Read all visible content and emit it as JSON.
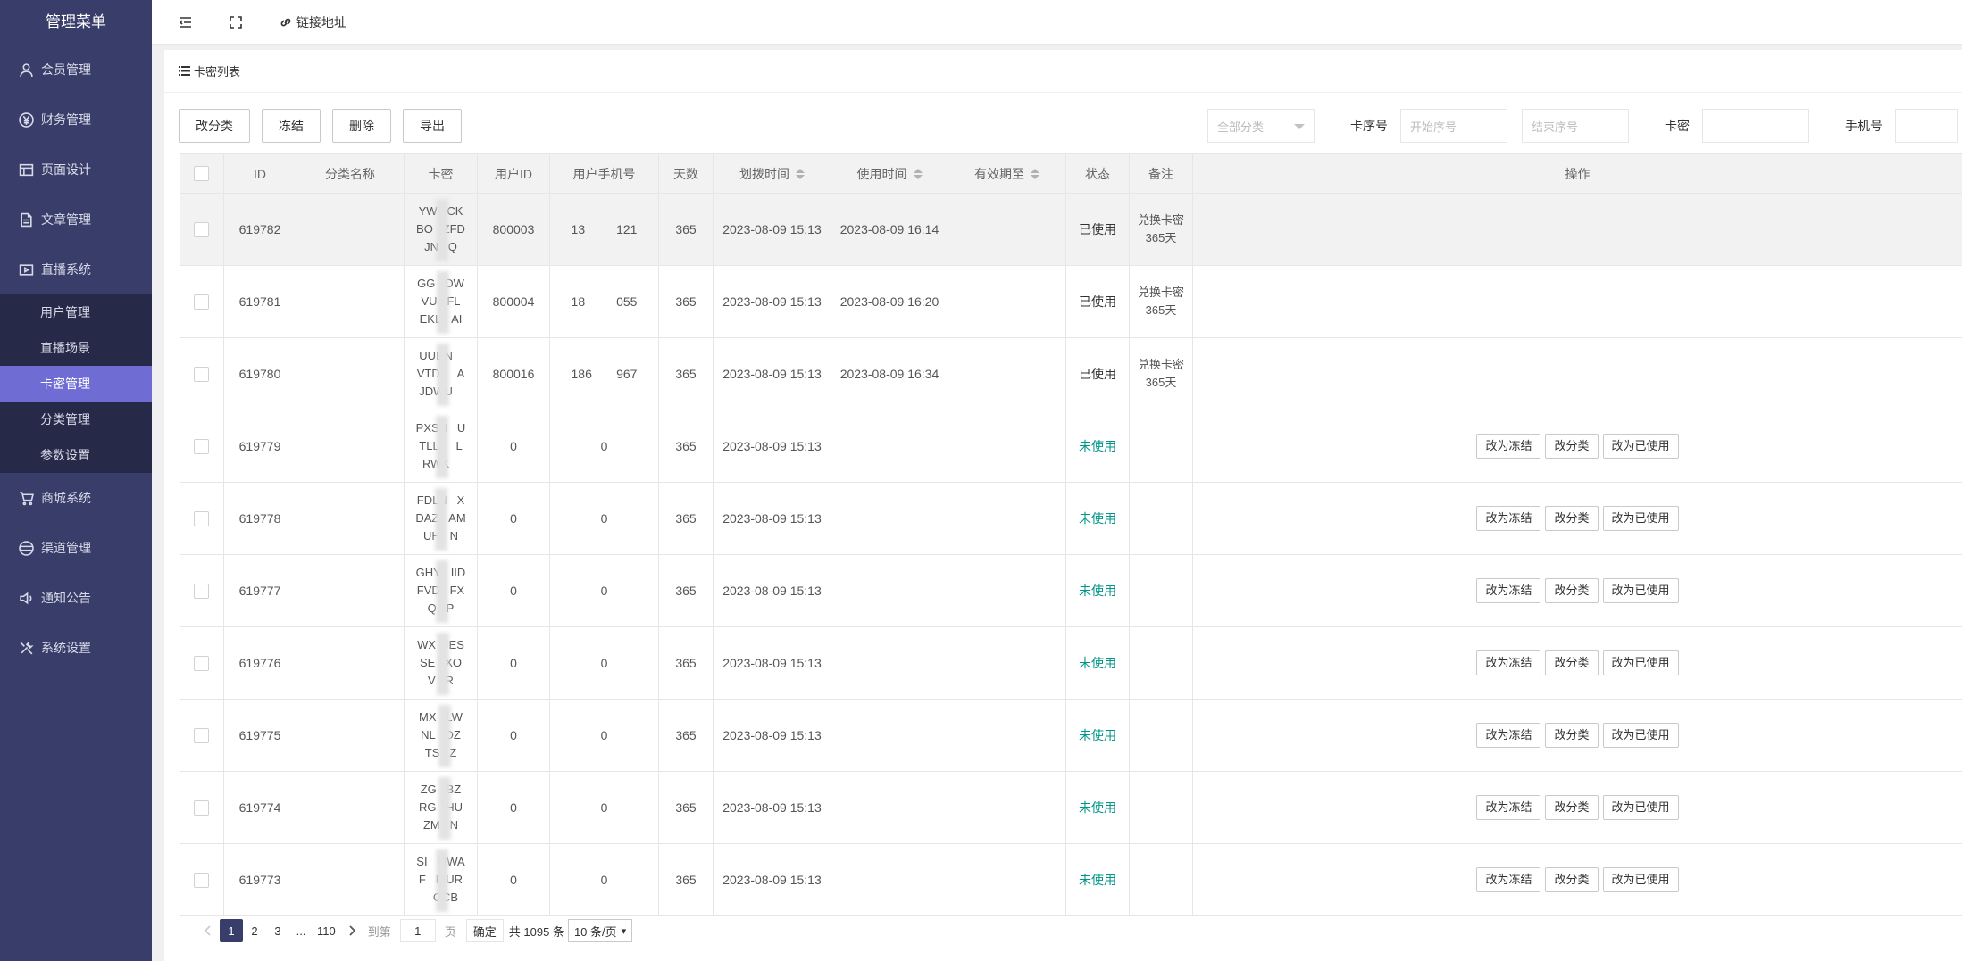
{
  "sidebar": {
    "title": "管理菜单",
    "items": [
      {
        "label": "会员管理",
        "icon": "user-icon"
      },
      {
        "label": "财务管理",
        "icon": "yen-icon"
      },
      {
        "label": "页面设计",
        "icon": "layout-icon"
      },
      {
        "label": "文章管理",
        "icon": "document-icon"
      },
      {
        "label": "直播系统",
        "icon": "video-icon"
      }
    ],
    "subitems": [
      {
        "label": "用户管理"
      },
      {
        "label": "直播场景"
      },
      {
        "label": "卡密管理",
        "active": true
      },
      {
        "label": "分类管理"
      },
      {
        "label": "参数设置"
      }
    ],
    "items2": [
      {
        "label": "商城系统",
        "icon": "cart-icon"
      },
      {
        "label": "渠道管理",
        "icon": "channel-icon"
      },
      {
        "label": "通知公告",
        "icon": "speaker-icon"
      },
      {
        "label": "系统设置",
        "icon": "tools-icon"
      }
    ]
  },
  "topbar": {
    "link_label": "链接地址"
  },
  "panel": {
    "title": "卡密列表"
  },
  "toolbar": {
    "change_category": "改分类",
    "freeze": "冻结",
    "delete": "删除",
    "export": "导出"
  },
  "filters": {
    "category_placeholder": "全部分类",
    "serial_label": "卡序号",
    "serial_start_placeholder": "开始序号",
    "serial_end_placeholder": "结束序号",
    "card_label": "卡密",
    "phone_label": "手机号"
  },
  "table": {
    "headers": [
      "ID",
      "分类名称",
      "卡密",
      "用户ID",
      "用户手机号",
      "天数",
      "划拨时间",
      "使用时间",
      "有效期至",
      "状态",
      "备注",
      "操作"
    ],
    "rows": [
      {
        "id": "619782",
        "category": "",
        "card": [
          "YW",
          "CK",
          "BO",
          "ZFD",
          "JN",
          "Q"
        ],
        "user_id": "800003",
        "phone": "13         121",
        "days": "365",
        "alloc_time": "2023-08-09 15:13",
        "use_time": "2023-08-09 16:14",
        "expire": "",
        "status": "已使用",
        "used": true,
        "note": [
          "兑换卡密",
          "365天"
        ]
      },
      {
        "id": "619781",
        "category": "",
        "card": [
          "GG",
          "DW",
          "VU",
          "FL",
          "EKL",
          "AI"
        ],
        "user_id": "800004",
        "phone": "18         055",
        "days": "365",
        "alloc_time": "2023-08-09 15:13",
        "use_time": "2023-08-09 16:20",
        "expire": "",
        "status": "已使用",
        "used": true,
        "note": [
          "兑换卡密",
          "365天"
        ]
      },
      {
        "id": "619780",
        "category": "",
        "card": [
          "UUDN",
          "",
          "VTDT",
          "A",
          "JDWU",
          ""
        ],
        "user_id": "800016",
        "phone": "186       967",
        "days": "365",
        "alloc_time": "2023-08-09 15:13",
        "use_time": "2023-08-09 16:34",
        "expire": "",
        "status": "已使用",
        "used": true,
        "note": [
          "兑换卡密",
          "365天"
        ]
      },
      {
        "id": "619779",
        "category": "",
        "card": [
          "PXSN",
          "U",
          "TLLZ",
          "L",
          "RWK",
          ""
        ],
        "user_id": "0",
        "phone": "0",
        "days": "365",
        "alloc_time": "2023-08-09 15:13",
        "use_time": "",
        "expire": "",
        "status": "未使用",
        "used": false,
        "note": []
      },
      {
        "id": "619778",
        "category": "",
        "card": [
          "FDLN",
          "X",
          "DAZ",
          "AM",
          "UH",
          "N"
        ],
        "user_id": "0",
        "phone": "0",
        "days": "365",
        "alloc_time": "2023-08-09 15:13",
        "use_time": "",
        "expire": "",
        "status": "未使用",
        "used": false,
        "note": []
      },
      {
        "id": "619777",
        "category": "",
        "card": [
          "GHY",
          "IID",
          "FVD",
          "FX",
          "Q",
          "P"
        ],
        "user_id": "0",
        "phone": "0",
        "days": "365",
        "alloc_time": "2023-08-09 15:13",
        "use_time": "",
        "expire": "",
        "status": "未使用",
        "used": false,
        "note": []
      },
      {
        "id": "619776",
        "category": "",
        "card": [
          "WX",
          "IES",
          "SE",
          "XO",
          "V",
          "R"
        ],
        "user_id": "0",
        "phone": "0",
        "days": "365",
        "alloc_time": "2023-08-09 15:13",
        "use_time": "",
        "expire": "",
        "status": "未使用",
        "used": false,
        "note": []
      },
      {
        "id": "619775",
        "category": "",
        "card": [
          "MX",
          "LW",
          "NL",
          "DZ",
          "TS",
          "Z"
        ],
        "user_id": "0",
        "phone": "0",
        "days": "365",
        "alloc_time": "2023-08-09 15:13",
        "use_time": "",
        "expire": "",
        "status": "未使用",
        "used": false,
        "note": []
      },
      {
        "id": "619774",
        "category": "",
        "card": [
          "ZG",
          "BZ",
          "RG",
          "HU",
          "ZM",
          "N"
        ],
        "user_id": "0",
        "phone": "0",
        "days": "365",
        "alloc_time": "2023-08-09 15:13",
        "use_time": "",
        "expire": "",
        "status": "未使用",
        "used": false,
        "note": []
      },
      {
        "id": "619773",
        "category": "",
        "card": [
          "SI",
          "MWA",
          "F",
          "FIUR",
          "",
          "GCB"
        ],
        "user_id": "0",
        "phone": "0",
        "days": "365",
        "alloc_time": "2023-08-09 15:13",
        "use_time": "",
        "expire": "",
        "status": "未使用",
        "used": false,
        "note": []
      }
    ],
    "op_labels": {
      "freeze": "改为冻结",
      "category": "改分类",
      "used": "改为已使用"
    }
  },
  "pager": {
    "pages": [
      "1",
      "2",
      "3",
      "...",
      "110"
    ],
    "goto_label": "到第",
    "goto_value": "1",
    "page_label": "页",
    "confirm": "确定",
    "total": "共 1095 条",
    "page_size": "10 条/页"
  }
}
